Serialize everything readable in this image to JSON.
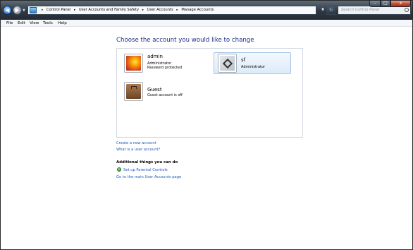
{
  "window": {
    "address_crumbs": [
      "Control Panel",
      "User Accounts and Family Safety",
      "User Accounts",
      "Manage Accounts"
    ],
    "crumb_separator": "▸",
    "search_placeholder": "Search Control Panel",
    "controls": {
      "minimize": "–",
      "maximize": "□",
      "close": "x"
    }
  },
  "menubar": {
    "file": "File",
    "edit": "Edit",
    "view": "View",
    "tools": "Tools",
    "help": "Help"
  },
  "main": {
    "heading": "Choose the account you would like to change",
    "accounts": [
      {
        "name": "admin",
        "lines": [
          "Administrator",
          "Password protected"
        ],
        "picture": "flower-picture"
      },
      {
        "name": "sf",
        "lines": [
          "Administrator"
        ],
        "picture": "robot-picture"
      },
      {
        "name": "Guest",
        "lines": [
          "Guest account is off"
        ],
        "picture": "guest-suitcase-picture"
      }
    ],
    "links": {
      "create": "Create a new account",
      "what_is": "What is a user account?"
    },
    "additional": {
      "heading": "Additional things you can do",
      "parental": "Set up Parental Controls",
      "main_page": "Go to the main User Accounts page"
    }
  },
  "colors": {
    "heading": "#1e3287",
    "link": "#1e56c2",
    "selection_border": "#a4c5e8"
  }
}
